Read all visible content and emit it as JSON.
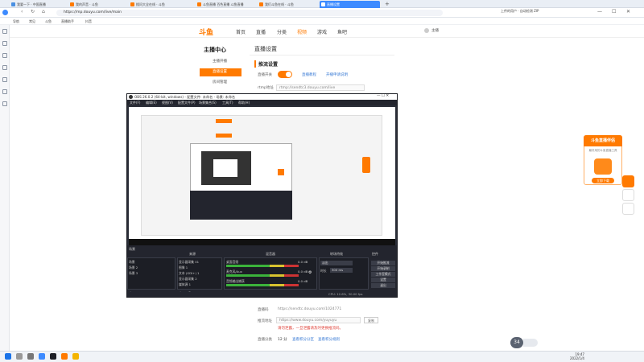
{
  "browser": {
    "tabs": [
      {
        "label": "我要一下 · 中国直播"
      },
      {
        "label": "我的声音 · 斗鱼"
      },
      {
        "label": "搜问大全在线 · 斗鱼"
      },
      {
        "label": "斗鱼直播 百色直播 斗鱼直播"
      },
      {
        "label": "我们斗鱼在线 · 斗鱼"
      },
      {
        "label": "直播设置"
      }
    ],
    "url": "https://mp.douyu.com/live/main",
    "bookmarks": [
      "导航",
      "常见",
      "斗鱼",
      "直播助手",
      "抖音",
      "斗鱼客户"
    ],
    "window_title_text": "上传的用户 · 自动检测 ZIP"
  },
  "site": {
    "logo": "斗鱼",
    "nav": [
      "首页",
      "直播",
      "分类",
      "视频",
      "游戏",
      "鱼吧"
    ],
    "user": "主播"
  },
  "sidebar": {
    "title": "主播中心",
    "items": [
      {
        "label": "主播开播"
      },
      {
        "label": "直播设置"
      },
      {
        "label": "房间管理"
      }
    ]
  },
  "main": {
    "page_title": "直播设置",
    "section": "推流设置",
    "fields": {
      "live_switch_label": "直播开关",
      "live_switch_link1": "直播教程",
      "live_switch_link2": "开播申请说明",
      "rtmp_label": "rtmp地址",
      "rtmp_value": "rtmp://sendtc3.douyu.com/live",
      "stream_label": "直播码",
      "stream_value": "https://sendtc.douyu.com/1024771",
      "preview_label": "推流地址",
      "preview_value": "https://www.douyu.com/yuyuyu",
      "copy_label": "复制",
      "warning": "请勿泄露，一旦泄露请及时更换推流码。",
      "level_label": "直播分类",
      "level_value": "12 分",
      "level_link1": "查看积分分区",
      "level_link2": "查看积分规则"
    }
  },
  "obs": {
    "title": "OBS 26.0.2 (64-bit, windows) - 配置文件: 未命名 - 场景: 未命名",
    "menu": [
      "文件(F)",
      "编辑(E)",
      "视图(V)",
      "配置文件(P)",
      "场景集合(S)",
      "工具(T)",
      "帮助(H)"
    ],
    "docks": [
      "场景",
      "来源",
      "混音器",
      "转场特效",
      "控件"
    ],
    "scenes": [
      "场景",
      "场景 2",
      "场景 3"
    ],
    "sources": [
      "显示器采集 01",
      "图像 1",
      "文本 (GDI+) 1",
      "显示器采集 2",
      "媒体源 1",
      "显示器采集 2"
    ],
    "mixer": [
      {
        "name": "桌面音频",
        "level": "0.0 dB"
      },
      {
        "name": "麦克风/Aux",
        "level": "0.0 dB"
      },
      {
        "name": "音频输出捕获",
        "level": "0.0 dB"
      }
    ],
    "transition": {
      "label": "淡出",
      "duration_label": "时长",
      "duration_value": "300 ms"
    },
    "controls": [
      "开始推流",
      "开始录制",
      "工作室模式",
      "设置",
      "退出"
    ],
    "status": "CPU: 12.6%, 30.00 fps"
  },
  "promo": {
    "title": "斗鱼直播伴侣",
    "subtitle": "最好用的斗鱼直播工具",
    "button": "立即下载"
  },
  "volume_badge": "34",
  "taskbar": {
    "time": "19:47",
    "date": "2022/1/4"
  },
  "colors": {
    "brand": "#ff7a00",
    "link": "#3a7bd5",
    "browser_accent": "#3d8bff"
  }
}
